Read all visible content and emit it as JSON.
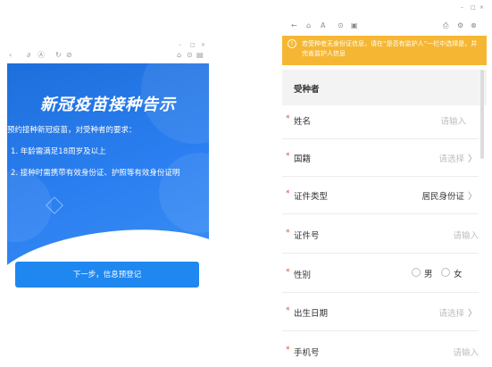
{
  "left_window": {
    "controls": {
      "minimize": "–",
      "maximize": "□",
      "close": "×"
    },
    "toolbar_icons": [
      "back-icon",
      "link-icon",
      "translate-icon",
      "refresh-icon",
      "compass-icon",
      "share-icon",
      "settings-icon",
      "more-icon"
    ],
    "notice": {
      "title": "新冠疫苗接种告示",
      "intro": "预约接种新冠疫苗，对受种者的要求：",
      "items": [
        "1. 年龄需满足18周岁及以上",
        "2. 接种时需携带有效身份证、护照等有效身份证明"
      ]
    },
    "next_button": "下一步，信息预登记"
  },
  "right_window": {
    "controls": {
      "minimize": "–",
      "maximize": "□",
      "close": "×"
    },
    "toolbar": {
      "back": "←",
      "home": "⌂",
      "text_size": "A",
      "share": "⊙",
      "bookmark": "▣",
      "save": "⎙",
      "settings": "⚙",
      "more": "⊗"
    },
    "warning": {
      "icon": "!",
      "text": "若受种者无身份证信息，请在“是否有监护人”一栏中选择是，并完善监护人信息"
    },
    "section_title": "受种者",
    "required_mark": "*",
    "chevron": "〉",
    "fields": [
      {
        "label": "姓名",
        "value": "请输入",
        "filled": false,
        "chevron": false
      },
      {
        "label": "国籍",
        "value": "请选择",
        "filled": false,
        "chevron": true
      },
      {
        "label": "证件类型",
        "value": "居民身份证",
        "filled": true,
        "chevron": true
      },
      {
        "label": "证件号",
        "value": "请输入",
        "filled": false,
        "chevron": false
      },
      {
        "label": "性别",
        "options": [
          "男",
          "女"
        ]
      },
      {
        "label": "出生日期",
        "value": "请选择",
        "filled": false,
        "chevron": true
      },
      {
        "label": "手机号",
        "value": "请输入",
        "filled": false,
        "chevron": false
      }
    ]
  },
  "colors": {
    "primary": "#1f87f0",
    "banner": "#2b7ff0",
    "warning": "#f5b733",
    "required": "#e34d3c",
    "placeholder": "#bdbdbd"
  }
}
